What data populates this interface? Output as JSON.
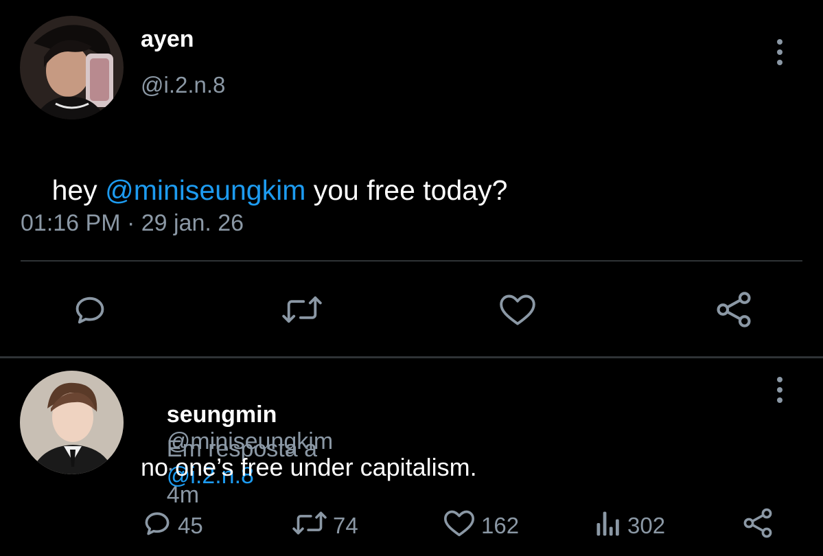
{
  "main_tweet": {
    "display_name": "ayen",
    "handle": "@i.2.n.8",
    "text_before": "hey ",
    "mention": "@miniseungkim",
    "text_after": " you free today?",
    "timestamp": "01:16 PM · 29 jan. 26"
  },
  "reply": {
    "display_name": "seungmin",
    "handle": "@miniseungkim",
    "separator": "·",
    "time": "4m",
    "reply_prefix": "Em resposta a",
    "reply_to": "@i.2.n.8",
    "text": "no one’s free under capitalism.",
    "stats": {
      "replies": "45",
      "retweets": "74",
      "likes": "162",
      "views": "302"
    }
  },
  "colors": {
    "background": "#000000",
    "accent": "#1d9bf0",
    "secondary_text": "#8b98a5",
    "divider": "#2f3336"
  }
}
